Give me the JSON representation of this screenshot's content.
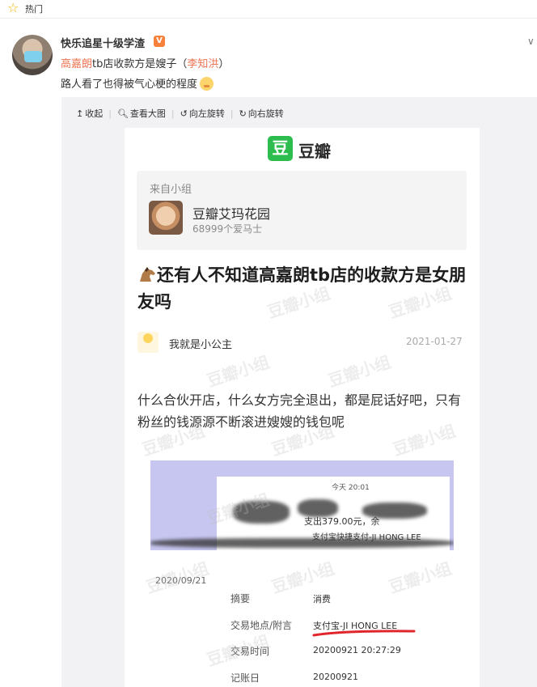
{
  "topbar": {
    "label": "热门",
    "icon": "star-icon"
  },
  "post": {
    "username": "快乐追星十级学渣",
    "verified_badge": "V",
    "line1": {
      "link1": "高嘉朗",
      "text1": "tb店收款方是嫂子（",
      "link2": "李知洪",
      "text2": "）"
    },
    "line2": "路人看了也得被气心梗的程度"
  },
  "toolbar": {
    "collapse": "收起",
    "view_large": "查看大图",
    "rotate_left": "向左旋转",
    "rotate_right": "向右旋转"
  },
  "douban": {
    "logo_char": "豆",
    "logo_text": "豆瓣",
    "from_label": "来自小组",
    "group_name": "豆瓣艾玛花园",
    "group_count": "68999个爱马士",
    "title": "还有人不知道高嘉朗tb店的收款方是女朋友吗",
    "author": "我就是小公主",
    "date": "2021-01-27",
    "body": "什么合伙开店，什么女方完全退出，都是屁话好吧，只有粉丝的钱源源不断滚进嫂嫂的钱包呢",
    "watermark": "豆瓣小组"
  },
  "screenshot": {
    "time": "今天 20:01",
    "amount": "支出379.00元，余",
    "payee": "支付宝快捷支付-JI HONG LEE"
  },
  "record": {
    "date": "2020/09/21",
    "rows": [
      {
        "label": "摘要",
        "value": "消费"
      },
      {
        "label": "交易地点/附言",
        "value": "支付宝-JI HONG LEE"
      },
      {
        "label": "交易时间",
        "value": "20200921 20:27:29"
      },
      {
        "label": "记账日",
        "value": "20200921"
      }
    ]
  },
  "colors": {
    "link": "#eb7350",
    "douban_green": "#2dbd4e",
    "underline": "#e0252c"
  }
}
